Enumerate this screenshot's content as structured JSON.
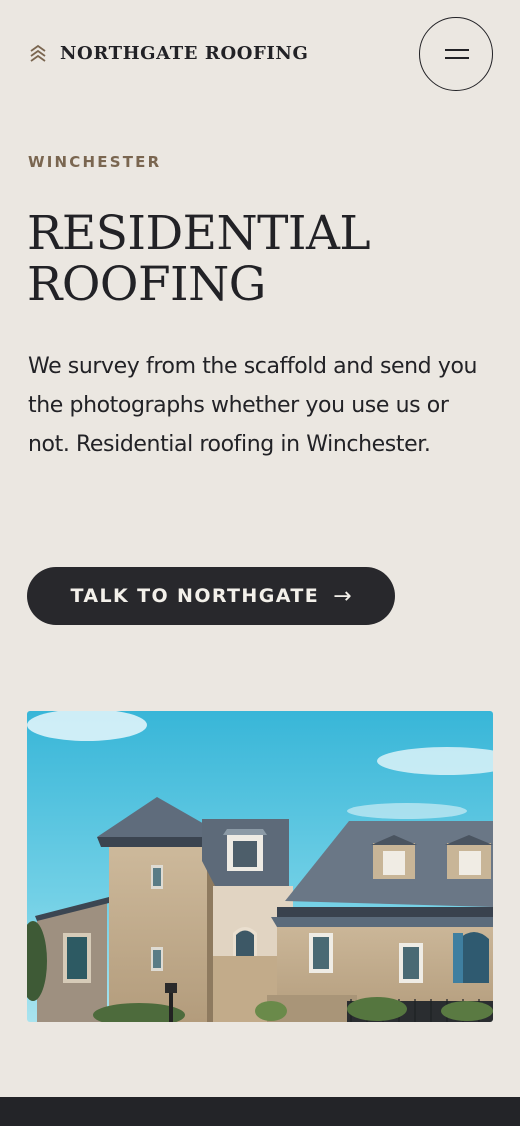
{
  "header": {
    "brand_name": "NORTHGATE ROOFING",
    "brand_icon": "chevrons-up-icon",
    "menu_icon": "hamburger-menu-icon"
  },
  "hero": {
    "eyebrow": "WINCHESTER",
    "title_line1": "RESIDENTIAL",
    "title_line2": "ROOFING",
    "lede": "We survey from the scaffold and send you the photographs whether you use us or not. Residential roofing in Winchester.",
    "cta_label": "TALK TO NORTHGATE",
    "cta_arrow": "→"
  },
  "colors": {
    "background": "#ebe7e1",
    "text": "#222226",
    "eyebrow": "#7a6650",
    "button": "#28282c",
    "footer": "#232428"
  }
}
